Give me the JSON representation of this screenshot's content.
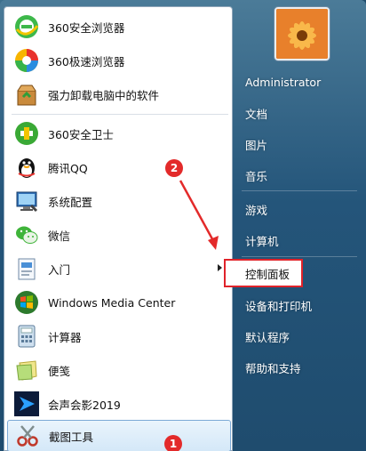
{
  "programs": [
    {
      "label": "360安全浏览器",
      "icon": "360-browser-icon"
    },
    {
      "label": "360极速浏览器",
      "icon": "360-speed-browser-icon"
    },
    {
      "label": "强力卸载电脑中的软件",
      "icon": "uninstall-box-icon"
    },
    {
      "label": "360安全卫士",
      "icon": "360-guard-icon"
    },
    {
      "label": "腾讯QQ",
      "icon": "qq-penguin-icon"
    },
    {
      "label": "系统配置",
      "icon": "system-config-icon"
    },
    {
      "label": "微信",
      "icon": "wechat-icon"
    },
    {
      "label": "入门",
      "icon": "getting-started-icon"
    },
    {
      "label": "Windows Media Center",
      "icon": "windows-media-center-icon"
    },
    {
      "label": "计算器",
      "icon": "calculator-icon"
    },
    {
      "label": "便笺",
      "icon": "sticky-notes-icon"
    },
    {
      "label": "会声会影2019",
      "icon": "videostudio-icon"
    },
    {
      "label": "截图工具",
      "icon": "snipping-tool-icon"
    }
  ],
  "places": {
    "user": "Administrator",
    "documents": "文档",
    "pictures": "图片",
    "music": "音乐",
    "games": "游戏",
    "computer": "计算机",
    "control_panel": "控制面板",
    "devices_printers": "设备和打印机",
    "default_programs": "默认程序",
    "help_support": "帮助和支持"
  },
  "annotations": {
    "step1": "1",
    "step2": "2",
    "color": "#e32a2a"
  }
}
